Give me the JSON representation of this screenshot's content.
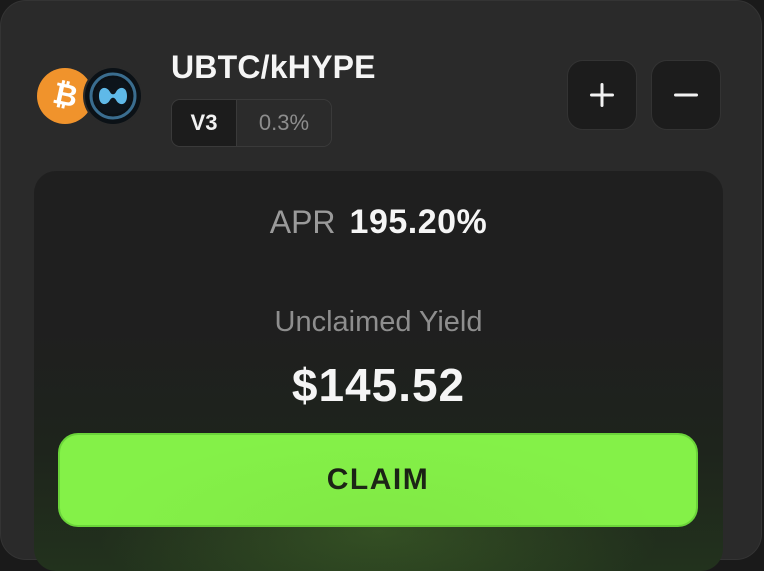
{
  "position": {
    "pair": "UBTC/kHYPE",
    "version": "V3",
    "fee": "0.3%",
    "tokens": [
      {
        "symbol": "UBTC",
        "icon": "bitcoin-icon",
        "color": "#f0932c"
      },
      {
        "symbol": "kHYPE",
        "icon": "khype-icon",
        "color": "#0b1116"
      }
    ]
  },
  "actions": {
    "add_icon": "plus-icon",
    "remove_icon": "minus-icon"
  },
  "stats": {
    "apr_label": "APR",
    "apr_value": "195.20%",
    "yield_label": "Unclaimed Yield",
    "yield_value": "$145.52"
  },
  "claim": {
    "label": "CLAIM",
    "color": "#84f148"
  }
}
